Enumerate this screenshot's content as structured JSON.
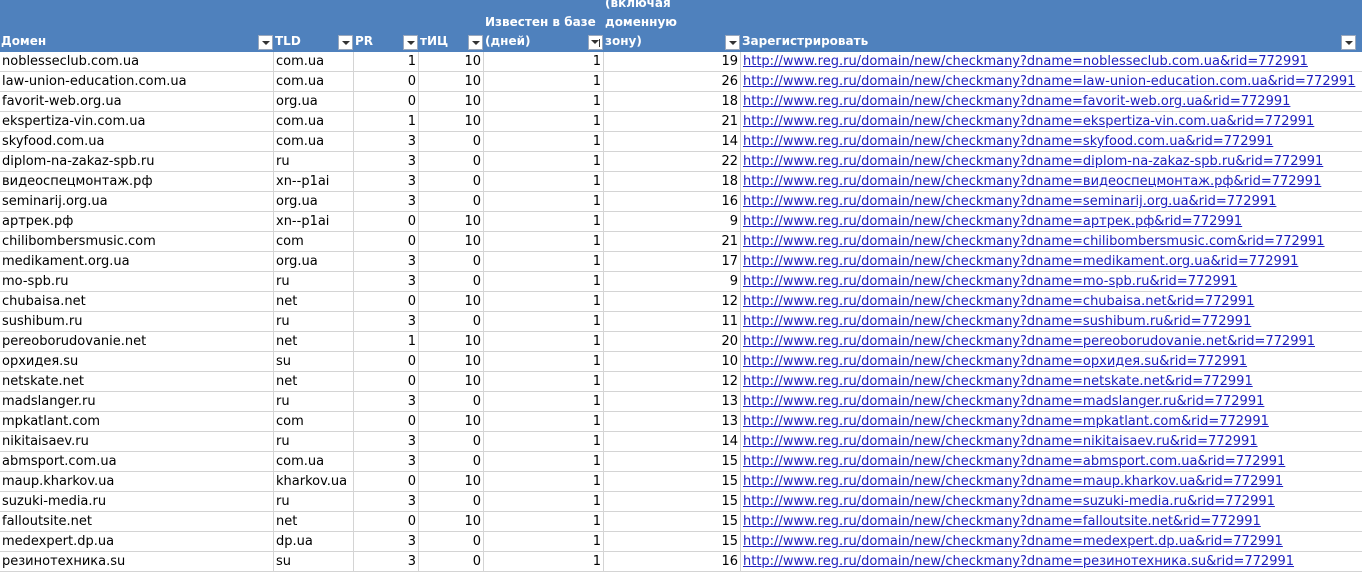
{
  "headers": {
    "domain": "Домен",
    "tld": "TLD",
    "pr": "PR",
    "tic": "тИЦ",
    "known": "Известен в базе\n(дней)",
    "chars": "Кол-во символов\n(включая доменную\nзону)",
    "register": "Зарегистрировать"
  },
  "rows": [
    {
      "domain": "noblesseclub.com.ua",
      "tld": "com.ua",
      "pr": "1",
      "tic": "10",
      "known": "1",
      "chars": "19",
      "link": "http://www.reg.ru/domain/new/checkmany?dname=noblesseclub.com.ua&rid=772991"
    },
    {
      "domain": "law-union-education.com.ua",
      "tld": "com.ua",
      "pr": "0",
      "tic": "10",
      "known": "1",
      "chars": "26",
      "link": "http://www.reg.ru/domain/new/checkmany?dname=law-union-education.com.ua&rid=772991"
    },
    {
      "domain": "favorit-web.org.ua",
      "tld": "org.ua",
      "pr": "0",
      "tic": "10",
      "known": "1",
      "chars": "18",
      "link": "http://www.reg.ru/domain/new/checkmany?dname=favorit-web.org.ua&rid=772991"
    },
    {
      "domain": "ekspertiza-vin.com.ua",
      "tld": "com.ua",
      "pr": "1",
      "tic": "10",
      "known": "1",
      "chars": "21",
      "link": "http://www.reg.ru/domain/new/checkmany?dname=ekspertiza-vin.com.ua&rid=772991"
    },
    {
      "domain": "skyfood.com.ua",
      "tld": "com.ua",
      "pr": "3",
      "tic": "0",
      "known": "1",
      "chars": "14",
      "link": "http://www.reg.ru/domain/new/checkmany?dname=skyfood.com.ua&rid=772991"
    },
    {
      "domain": "diplom-na-zakaz-spb.ru",
      "tld": "ru",
      "pr": "3",
      "tic": "0",
      "known": "1",
      "chars": "22",
      "link": "http://www.reg.ru/domain/new/checkmany?dname=diplom-na-zakaz-spb.ru&rid=772991"
    },
    {
      "domain": "видеоспецмонтаж.рф",
      "tld": "xn--p1ai",
      "pr": "3",
      "tic": "0",
      "known": "1",
      "chars": "18",
      "link": "http://www.reg.ru/domain/new/checkmany?dname=видеоспецмонтаж.рф&rid=772991"
    },
    {
      "domain": "seminarij.org.ua",
      "tld": "org.ua",
      "pr": "3",
      "tic": "0",
      "known": "1",
      "chars": "16",
      "link": "http://www.reg.ru/domain/new/checkmany?dname=seminarij.org.ua&rid=772991"
    },
    {
      "domain": "артрек.рф",
      "tld": "xn--p1ai",
      "pr": "0",
      "tic": "10",
      "known": "1",
      "chars": "9",
      "link": "http://www.reg.ru/domain/new/checkmany?dname=артрек.рф&rid=772991"
    },
    {
      "domain": "chilibombersmusic.com",
      "tld": "com",
      "pr": "0",
      "tic": "10",
      "known": "1",
      "chars": "21",
      "link": "http://www.reg.ru/domain/new/checkmany?dname=chilibombersmusic.com&rid=772991"
    },
    {
      "domain": "medikament.org.ua",
      "tld": "org.ua",
      "pr": "3",
      "tic": "0",
      "known": "1",
      "chars": "17",
      "link": "http://www.reg.ru/domain/new/checkmany?dname=medikament.org.ua&rid=772991"
    },
    {
      "domain": "mo-spb.ru",
      "tld": "ru",
      "pr": "3",
      "tic": "0",
      "known": "1",
      "chars": "9",
      "link": "http://www.reg.ru/domain/new/checkmany?dname=mo-spb.ru&rid=772991"
    },
    {
      "domain": "chubaisa.net",
      "tld": "net",
      "pr": "0",
      "tic": "10",
      "known": "1",
      "chars": "12",
      "link": "http://www.reg.ru/domain/new/checkmany?dname=chubaisa.net&rid=772991"
    },
    {
      "domain": "sushibum.ru",
      "tld": "ru",
      "pr": "3",
      "tic": "0",
      "known": "1",
      "chars": "11",
      "link": "http://www.reg.ru/domain/new/checkmany?dname=sushibum.ru&rid=772991"
    },
    {
      "domain": "pereoborudovanie.net",
      "tld": "net",
      "pr": "1",
      "tic": "10",
      "known": "1",
      "chars": "20",
      "link": "http://www.reg.ru/domain/new/checkmany?dname=pereoborudovanie.net&rid=772991"
    },
    {
      "domain": "орхидея.su",
      "tld": "su",
      "pr": "0",
      "tic": "10",
      "known": "1",
      "chars": "10",
      "link": "http://www.reg.ru/domain/new/checkmany?dname=орхидея.su&rid=772991"
    },
    {
      "domain": "netskate.net",
      "tld": "net",
      "pr": "0",
      "tic": "10",
      "known": "1",
      "chars": "12",
      "link": "http://www.reg.ru/domain/new/checkmany?dname=netskate.net&rid=772991"
    },
    {
      "domain": "madslanger.ru",
      "tld": "ru",
      "pr": "3",
      "tic": "0",
      "known": "1",
      "chars": "13",
      "link": "http://www.reg.ru/domain/new/checkmany?dname=madslanger.ru&rid=772991"
    },
    {
      "domain": "mpkatlant.com",
      "tld": "com",
      "pr": "0",
      "tic": "10",
      "known": "1",
      "chars": "13",
      "link": "http://www.reg.ru/domain/new/checkmany?dname=mpkatlant.com&rid=772991"
    },
    {
      "domain": "nikitaisaev.ru",
      "tld": "ru",
      "pr": "3",
      "tic": "0",
      "known": "1",
      "chars": "14",
      "link": "http://www.reg.ru/domain/new/checkmany?dname=nikitaisaev.ru&rid=772991"
    },
    {
      "domain": "abmsport.com.ua",
      "tld": "com.ua",
      "pr": "3",
      "tic": "0",
      "known": "1",
      "chars": "15",
      "link": "http://www.reg.ru/domain/new/checkmany?dname=abmsport.com.ua&rid=772991"
    },
    {
      "domain": "maup.kharkov.ua",
      "tld": "kharkov.ua",
      "pr": "0",
      "tic": "10",
      "known": "1",
      "chars": "15",
      "link": "http://www.reg.ru/domain/new/checkmany?dname=maup.kharkov.ua&rid=772991"
    },
    {
      "domain": "suzuki-media.ru",
      "tld": "ru",
      "pr": "3",
      "tic": "0",
      "known": "1",
      "chars": "15",
      "link": "http://www.reg.ru/domain/new/checkmany?dname=suzuki-media.ru&rid=772991"
    },
    {
      "domain": "falloutsite.net",
      "tld": "net",
      "pr": "0",
      "tic": "10",
      "known": "1",
      "chars": "15",
      "link": "http://www.reg.ru/domain/new/checkmany?dname=falloutsite.net&rid=772991"
    },
    {
      "domain": "medexpert.dp.ua",
      "tld": "dp.ua",
      "pr": "3",
      "tic": "0",
      "known": "1",
      "chars": "15",
      "link": "http://www.reg.ru/domain/new/checkmany?dname=medexpert.dp.ua&rid=772991"
    },
    {
      "domain": "резинотехника.su",
      "tld": "su",
      "pr": "3",
      "tic": "0",
      "known": "1",
      "chars": "16",
      "link": "http://www.reg.ru/domain/new/checkmany?dname=резинотехника.su&rid=772991"
    }
  ],
  "colors": {
    "header_bg": "#4f81bd",
    "header_text": "#ffffff",
    "link": "#1f1fbf",
    "grid": "#d4d4d4"
  }
}
